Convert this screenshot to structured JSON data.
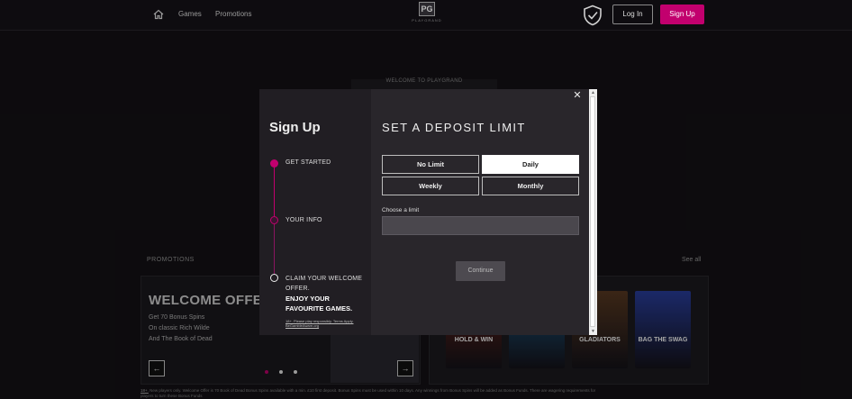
{
  "nav": {
    "games": "Games",
    "promotions": "Promotions",
    "logo_mark": "PG",
    "logo_text": "PLAYGRAND",
    "login": "Log In",
    "signup": "Sign Up"
  },
  "page": {
    "welcome_title": "WELCOME TO PLAYGRAND",
    "promotions_heading": "PROMOTIONS",
    "see_all": "See all",
    "promo": {
      "title": "WELCOME OFFER",
      "lines": [
        "Get 70 Bonus Spins",
        "On classic Rich Wilde",
        "And The Book of Dead"
      ]
    },
    "games": [
      {
        "title": "HOLD & WIN",
        "color": "#6a2418"
      },
      {
        "title": "",
        "color": "#1c5f8c"
      },
      {
        "title": "GLADIATORS",
        "color": "#5a3a22"
      },
      {
        "title": "BAG THE SWAG",
        "color": "#2a3fa0"
      }
    ],
    "disclaimer_prefix": "18+.",
    "disclaimer": "New players only. Welcome Offer is 70 Book of Dead Bonus Spins available with a min. £10 first deposit. Bonus Spins must be used within 10 days. Any winnings from Bonus Spins will be added as Bonus Funds. There are wagering requirements for players to turn these Bonus Funds"
  },
  "modal": {
    "heading": "Sign Up",
    "steps": [
      "GET STARTED",
      "YOUR INFO",
      "CLAIM YOUR WELCOME OFFER."
    ],
    "step3_sub": "ENJOY YOUR FAVOURITE GAMES.",
    "fine_print": "18+. Please play responsibly. Terms Apply. BeGambleAware.org",
    "title": "SET A DEPOSIT LIMIT",
    "options": {
      "no_limit": "No Limit",
      "daily": "Daily",
      "weekly": "Weekly",
      "monthly": "Monthly"
    },
    "selected_option": "Daily",
    "limit_label": "Choose a limit",
    "limit_value": "",
    "continue": "Continue",
    "colors": {
      "accent": "#c2006e",
      "step_line": "#8a1560"
    }
  }
}
